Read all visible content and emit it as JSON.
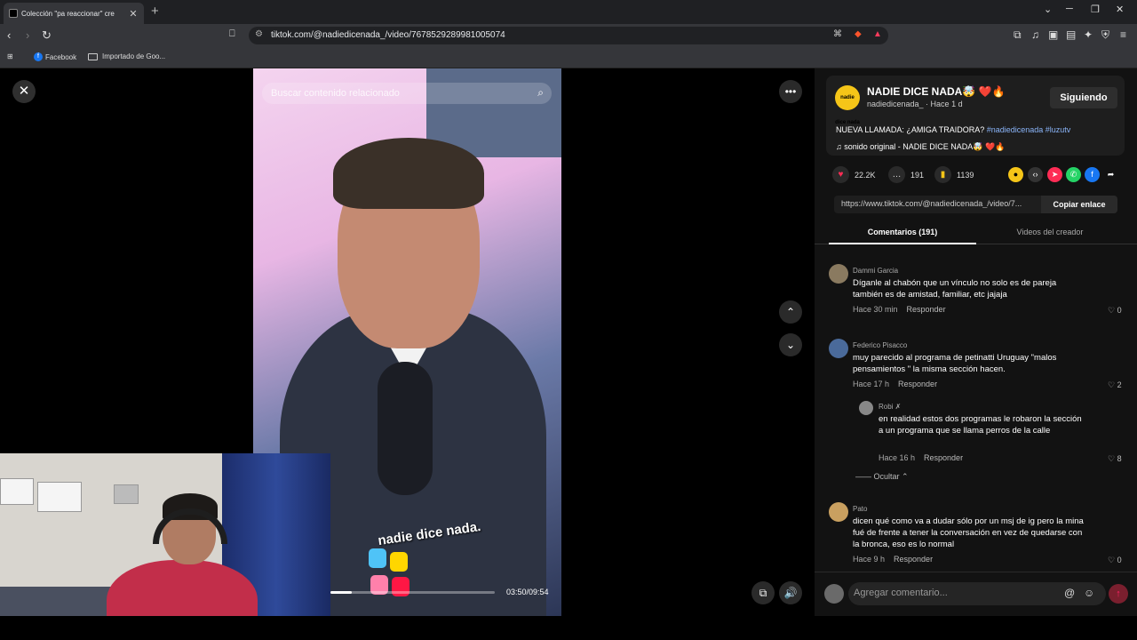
{
  "browser": {
    "tab_title": "Colección \"pa reaccionar\" cre",
    "new_tab": "+",
    "url": "tiktok.com/@nadiedicenada_/video/7678529289981005074",
    "bookmarks": [
      "Facebook",
      "Importado de Goo..."
    ]
  },
  "viewer": {
    "search_placeholder": "Buscar contenido relacionado",
    "brand_overlay": "nadie dice nada.",
    "time": "03:50/09:54",
    "progress_fraction": 0.13
  },
  "post": {
    "author": "NADIE DICE NADA🤯 ❤️🔥",
    "handle": "nadiedicenada_ · Hace 1 d",
    "follow_label": "Siguiendo",
    "avatar_text": "nadie dice nada",
    "description": "NUEVA LLAMADA: ¿AMIGA TRAIDORA?",
    "tags": "#nadiedicenada #luzutv",
    "sound": "♫  sonido original - NADIE DICE NADA🤯 ❤️🔥",
    "likes": "22.2K",
    "comments": "191",
    "saves": "1139",
    "link": "https://www.tiktok.com/@nadiedicenada_/video/7...",
    "copy_label": "Copiar enlace"
  },
  "tabs": {
    "comments": "Comentarios (191)",
    "creator_videos": "Videos del creador"
  },
  "comments": [
    {
      "name": "Dammi Garcia",
      "text": "Díganle al chabón que un vínculo no solo es de pareja también es de amistad, familiar, etc jajaja",
      "time": "Hace 30 min",
      "reply": "Responder",
      "likes": "0"
    },
    {
      "name": "Federico Pisacco",
      "text": "muy parecido al programa de petinatti Uruguay \"malos pensamientos \" la misma sección hacen.",
      "time": "Hace 17 h",
      "reply": "Responder",
      "likes": "2"
    },
    {
      "name": "Robi ✗",
      "text": "en realidad estos dos programas le robaron la sección a un programa que se llama perros de la calle",
      "time": "Hace 16 h",
      "reply": "Responder",
      "likes": "8"
    },
    {
      "name": "Pato",
      "text": "dicen qué como va a dudar sólo por un msj de ig pero la mina fué de frente a tener la conversación en vez de quedarse con la bronca, eso es lo normal",
      "time": "Hace 9 h",
      "reply": "Responder",
      "likes": "0"
    }
  ],
  "hide_label": "Ocultar",
  "composer_placeholder": "Agregar comentario...",
  "colors": {
    "accent": "#fe2c55",
    "tag": "#8ab4f8"
  }
}
